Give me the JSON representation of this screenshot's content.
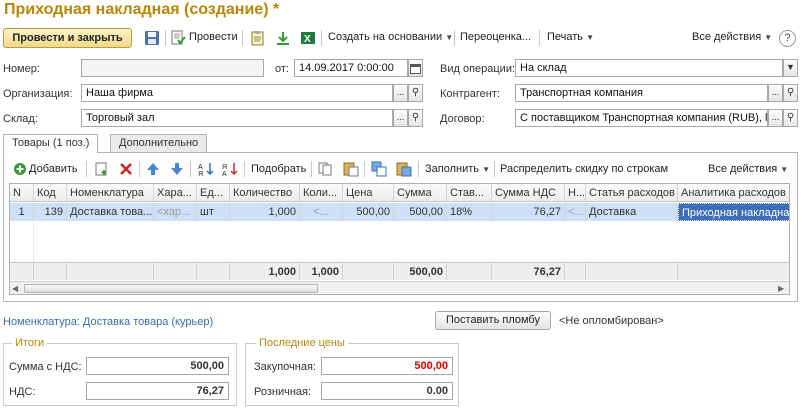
{
  "window": {
    "title": "Приходная накладная (создание) *"
  },
  "toolbar": {
    "post_close": "Провести и закрыть",
    "post": "Провести",
    "create_based": "Создать на основании",
    "revaluation": "Переоценка...",
    "print": "Печать",
    "all_actions": "Все действия",
    "help": "?"
  },
  "form": {
    "number_label": "Номер:",
    "number_value": "",
    "from_label": "от:",
    "date_value": "14.09.2017  0:00:00",
    "operation_label": "Вид операции:",
    "operation_value": "На склад",
    "org_label": "Организация:",
    "org_value": "Наша фирма",
    "counterparty_label": "Контрагент:",
    "counterparty_value": "Транспортная компания",
    "warehouse_label": "Склад:",
    "warehouse_value": "Торговый зал",
    "contract_label": "Договор:",
    "contract_value": "С поставщиком Транспортная компания (RUB), l"
  },
  "tabs": [
    {
      "label": "Товары (1 поз.)",
      "active": true
    },
    {
      "label": "Дополнительно",
      "active": false
    }
  ],
  "grid_toolbar": {
    "add": "Добавить",
    "select": "Подобрать",
    "fill": "Заполнить",
    "distribute": "Распределить скидку по строкам",
    "all_actions": "Все действия"
  },
  "table": {
    "columns": [
      "N",
      "Код",
      "Номенклатура",
      "Хара...",
      "Ед...",
      "Количество",
      "Коли...",
      "Цена",
      "Сумма",
      "Став...",
      "Сумма НДС",
      "Н...",
      "Статья расходов",
      "Аналитика расходов"
    ],
    "rows": [
      [
        "1",
        "139",
        "Доставка това...",
        "<хар...",
        "шт",
        "1,000",
        "<...",
        "500,00",
        "500,00",
        "18%",
        "76,27",
        "<...",
        "Доставка",
        "Приходная накладная"
      ]
    ],
    "footer": [
      "",
      "",
      "",
      "",
      "",
      "1,000",
      "1,000",
      "",
      "500,00",
      "",
      "76,27",
      "",
      "",
      ""
    ]
  },
  "info": {
    "nomenclature_link": "Номенклатура: Доставка товара (курьер)",
    "seal_button": "Поставить пломбу",
    "seal_status": "<Не опломбирован>"
  },
  "totals": {
    "title": "Итоги",
    "sum_label": "Сумма с НДС:",
    "sum_value": "500,00",
    "vat_label": "НДС:",
    "vat_value": "76,27"
  },
  "last_prices": {
    "title": "Последние цены",
    "purchase_label": "Закупочная:",
    "purchase_value": "500,00",
    "retail_label": "Розничная:",
    "retail_value": "0.00"
  },
  "colors": {
    "title": "#b8860b",
    "purchase_value": "#e00000",
    "selection": "#3d6dbb",
    "row_highlight": "#cde0f7"
  },
  "icons": [
    "save-icon",
    "post-doc-icon",
    "clipboard-icon",
    "download-icon",
    "excel-icon",
    "add-icon",
    "copy-add-icon",
    "delete-icon",
    "arrow-up-icon",
    "arrow-down-icon",
    "sort-asc-icon",
    "sort-desc-icon",
    "copy-icon",
    "paste-icon",
    "copy-rows-icon",
    "paste-rows-icon"
  ]
}
